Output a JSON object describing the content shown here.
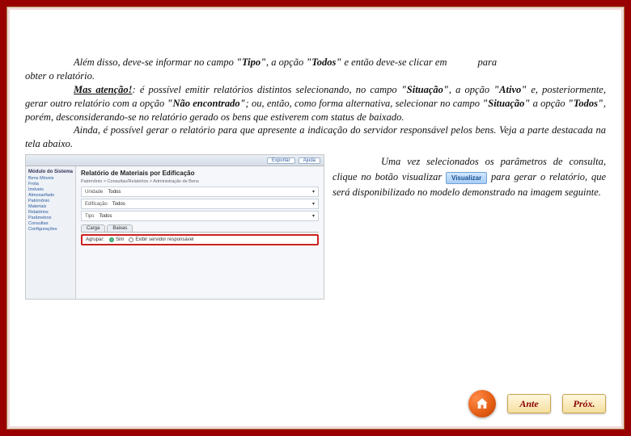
{
  "para1": {
    "l1a": "Além disso, deve-se informar no campo ",
    "tipo": "\"Tipo\"",
    "l1b": ", a opção ",
    "todos": "\"Todos\"",
    "l1c": " e então deve-se clicar em",
    "l1_right": "para",
    "l2": "obter o relatório."
  },
  "para2": {
    "attn": "Mas atenção!",
    "a": ": é possível emitir relatórios distintos selecionando, no campo ",
    "sit": "\"Situação\"",
    "b": ", a opção ",
    "ativo": "\"Ativo\"",
    "c": " e, posteriormente, gerar outro relatório com a opção ",
    "nao": "\"Não encontrado\"",
    "d": "; ou, então, como forma alternativa, selecionar no campo ",
    "sit2": "\"Situação\"",
    "e": " a opção ",
    "todos2": "\"Todos\"",
    "f": ", porém, desconsiderando-se no relatório gerado os bens que estiverem com status de baixado."
  },
  "para3": "Ainda, é possível gerar o relatório para que apresente a indicação do servidor responsável pelos bens. Veja a parte destacada na tela abaixo.",
  "sideText": {
    "a": "Uma vez selecionados os parâmetros de consulta, clique no botão visualizar ",
    "btn": "Visualizar",
    "b": " para gerar o relatório, que será disponibilizado no modelo demonstrado na imagem seguinte."
  },
  "screenshot": {
    "title": "Relatório de Materiais por Edificação",
    "topButtons": [
      "Exportar",
      "Ajuda"
    ],
    "side": {
      "group": "Módulo do Sistema",
      "links": [
        "Bens Móveis",
        "Frota",
        "Imóveis",
        "Almoxarifado",
        "Patrimônio",
        "Materiais",
        "Relatórios",
        "Parâmetros",
        "Consultas",
        "Configurações"
      ]
    },
    "breadcrumb": "Patrimônio > Consultas/Relatórios > Administração de Bens",
    "rows": [
      {
        "label": "Unidade",
        "value": "Todos"
      },
      {
        "label": "Edificação",
        "value": "Todos"
      },
      {
        "label": "Tipo",
        "value": "Todos"
      }
    ],
    "tabs": [
      "Carga",
      "Baixas"
    ],
    "highlight": {
      "label": "Agrupar:",
      "optSel": "Sim",
      "optUnsel": "Exibir servidor responsável"
    }
  },
  "nav": {
    "prev": "Ante",
    "next": "Próx."
  }
}
